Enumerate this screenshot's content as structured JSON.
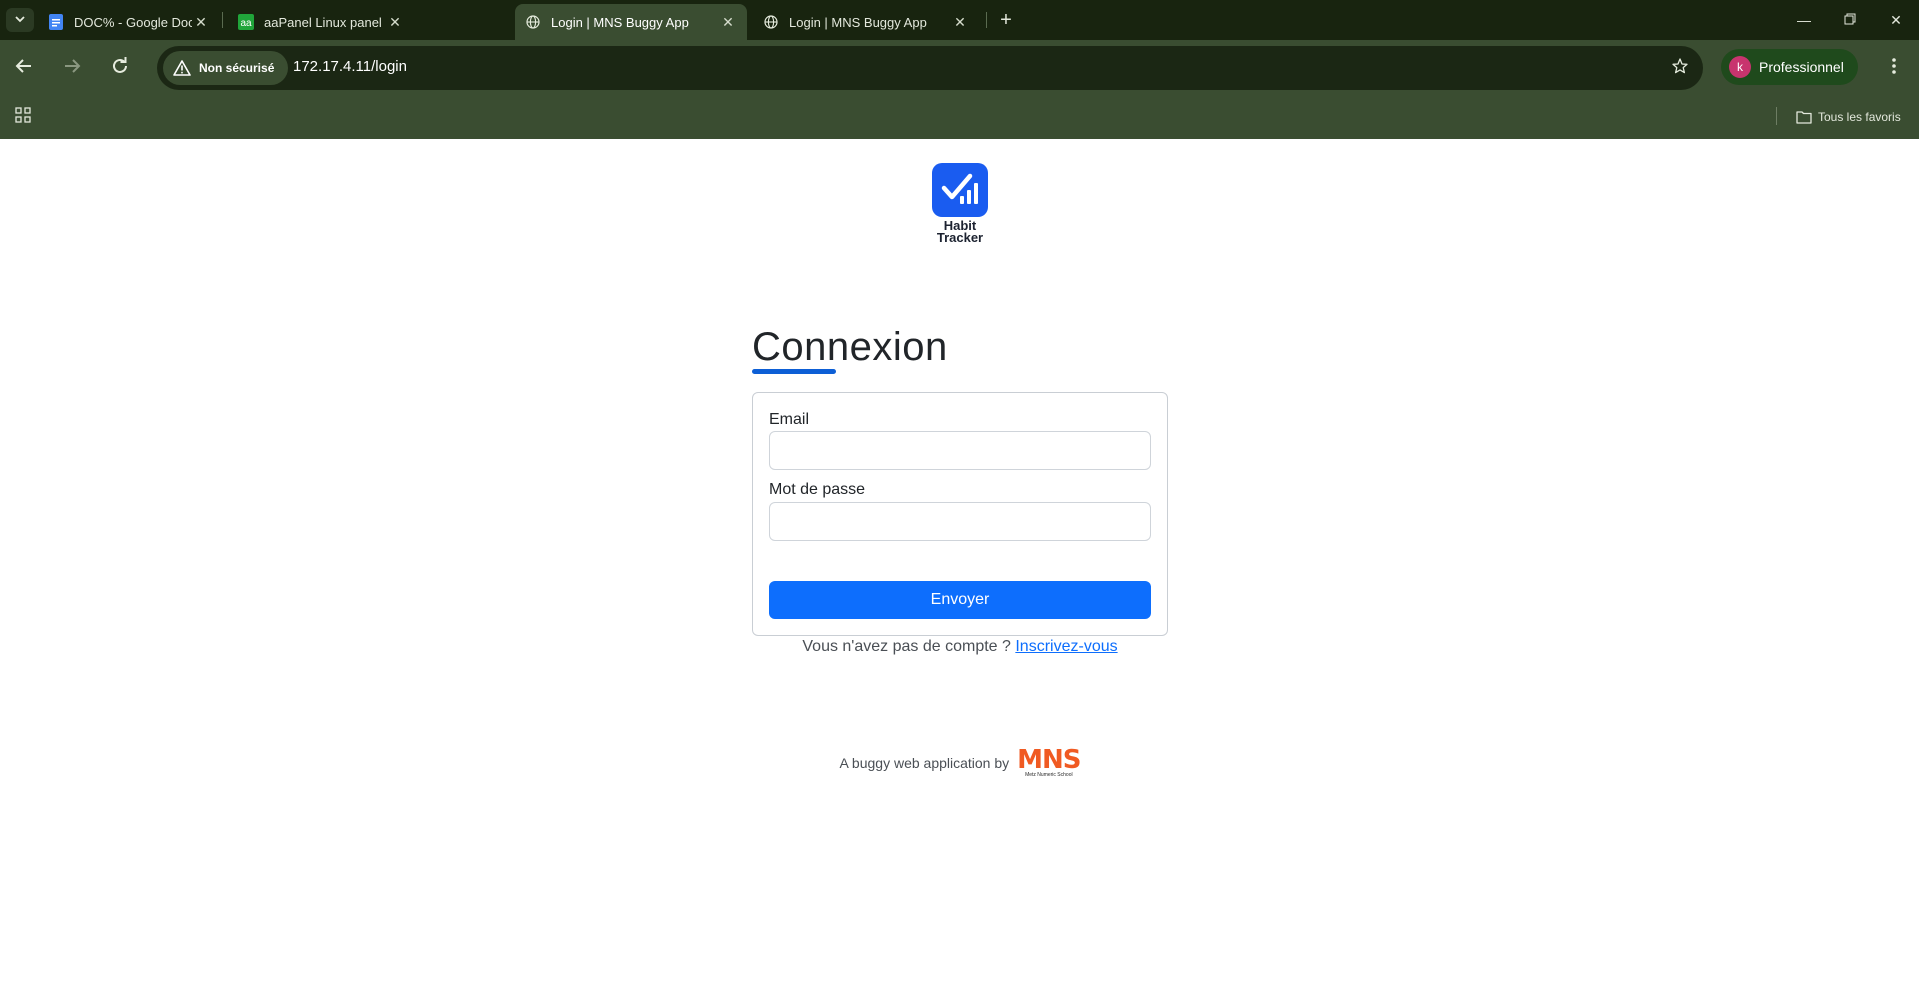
{
  "browser": {
    "tabs": [
      {
        "title": "DOC% - Google Docs",
        "icon": "google-docs-icon",
        "active": false
      },
      {
        "title": "aaPanel Linux panel",
        "icon": "aapanel-icon",
        "active": false
      },
      {
        "title": "Login | MNS Buggy App",
        "icon": "globe-icon",
        "active": true
      },
      {
        "title": "Login | MNS Buggy App",
        "icon": "globe-icon",
        "active": false
      }
    ],
    "security_label": "Non sécurisé",
    "url": "172.17.4.11/login",
    "profile": {
      "initial": "k",
      "label": "Professionnel"
    },
    "bookmarks": {
      "all_label": "Tous les favoris"
    }
  },
  "page": {
    "logo": {
      "line1": "Habit",
      "line2": "Tracker"
    },
    "heading": "Connexion",
    "form": {
      "email_label": "Email",
      "email_value": "",
      "password_label": "Mot de passe",
      "password_value": "",
      "submit_label": "Envoyer"
    },
    "signup": {
      "prompt": "Vous n'avez pas de compte ?",
      "link": "Inscrivez-vous"
    },
    "footer": {
      "text": "A buggy web application by",
      "brand": "MNS",
      "brand_sub": "Metz Numeric School"
    }
  },
  "colors": {
    "chrome_dark": "#18240f",
    "chrome_toolbar": "#3a4d31",
    "primary": "#0d6efd",
    "logo_blue": "#1a5cf0",
    "mns_orange": "#f05a22"
  }
}
